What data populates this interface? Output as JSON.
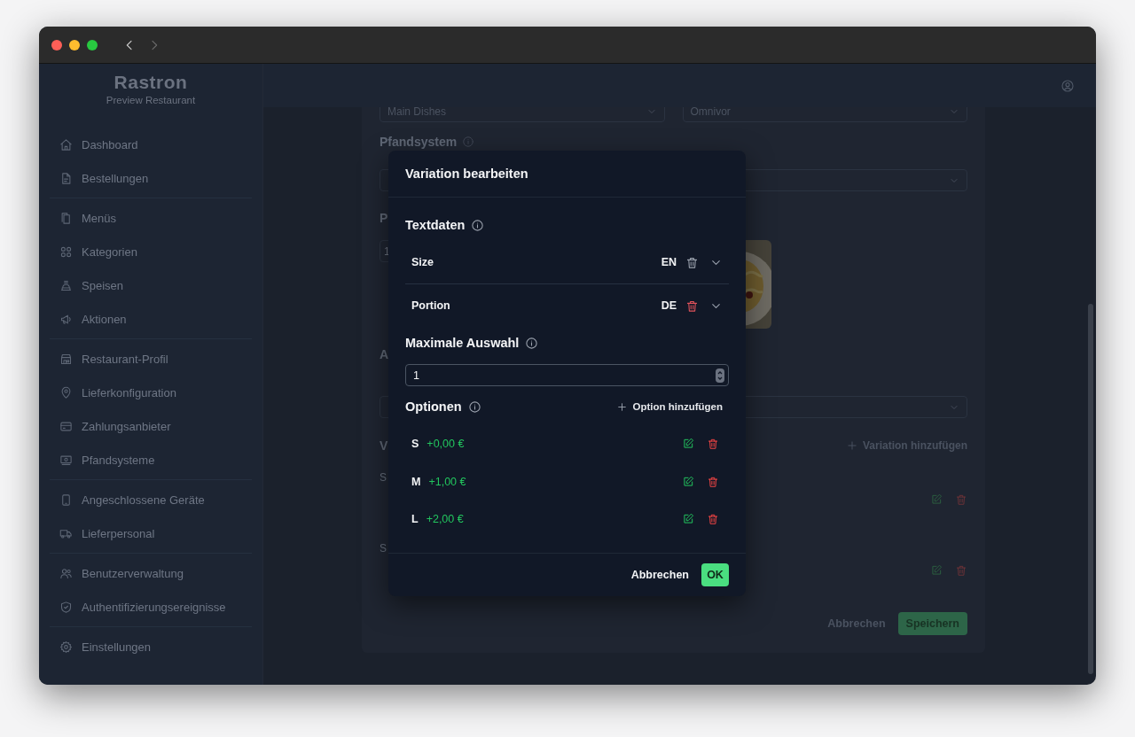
{
  "window": {
    "back_disabled": false,
    "forward_disabled": true
  },
  "sidebar": {
    "logo": "Rastron",
    "restaurant": "Preview Restaurant",
    "groups": [
      {
        "items": [
          {
            "label": "Dashboard"
          },
          {
            "label": "Bestellungen"
          }
        ]
      },
      {
        "items": [
          {
            "label": "Menüs"
          },
          {
            "label": "Kategorien"
          },
          {
            "label": "Speisen"
          },
          {
            "label": "Aktionen"
          }
        ]
      },
      {
        "items": [
          {
            "label": "Restaurant-Profil"
          },
          {
            "label": "Lieferkonfiguration"
          },
          {
            "label": "Zahlungsanbieter"
          },
          {
            "label": "Pfandsysteme"
          }
        ]
      },
      {
        "items": [
          {
            "label": "Angeschlossene Geräte"
          },
          {
            "label": "Lieferpersonal"
          }
        ]
      },
      {
        "items": [
          {
            "label": "Benutzerverwaltung"
          },
          {
            "label": "Authentifizierungsereignisse"
          }
        ]
      },
      {
        "items": [
          {
            "label": "Einstellungen"
          }
        ]
      }
    ]
  },
  "form": {
    "top_selects": [
      {
        "value": "Main Dishes"
      },
      {
        "value": "Omnivor"
      }
    ],
    "deposit_label": "Pfandsystem",
    "price_label": "P",
    "price_value": "1",
    "allergen_label": "A",
    "variations_label": "V",
    "add_variation": "Variation hinzufügen",
    "variation_rows": [
      {
        "name": "S"
      },
      {
        "name": "S"
      }
    ],
    "cancel": "Abbrechen",
    "save": "Speichern"
  },
  "dialog": {
    "title": "Variation bearbeiten",
    "textdata_title": "Textdaten",
    "texts": [
      {
        "label": "Size",
        "lang": "EN",
        "delete_disabled": true
      },
      {
        "label": "Portion",
        "lang": "DE",
        "delete_disabled": false
      }
    ],
    "max_title": "Maximale Auswahl",
    "max_value": "1",
    "options_title": "Optionen",
    "add_option": "Option hinzufügen",
    "options": [
      {
        "name": "S",
        "price": "+0,00 €"
      },
      {
        "name": "M",
        "price": "+1,00 €"
      },
      {
        "name": "L",
        "price": "+2,00 €"
      }
    ],
    "cancel": "Abbrechen",
    "ok": "OK"
  }
}
